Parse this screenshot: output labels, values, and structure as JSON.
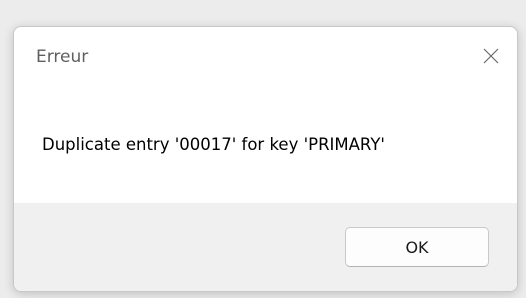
{
  "dialog": {
    "title": "Erreur",
    "message": "Duplicate entry '00017' for key 'PRIMARY'",
    "ok_label": "OK",
    "close_icon": "close-icon"
  }
}
